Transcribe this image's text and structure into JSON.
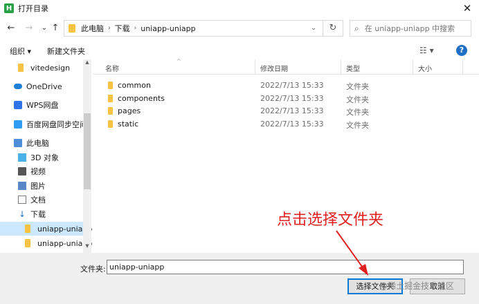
{
  "window": {
    "app_icon_letter": "H",
    "title": "打开目录",
    "close_glyph": "✕"
  },
  "nav": {
    "back_glyph": "←",
    "forward_glyph": "→",
    "history_glyph": "⌄",
    "up_glyph": "↑",
    "breadcrumbs": [
      "此电脑",
      "下载",
      "uniapp-uniapp"
    ],
    "crumb_sep": "›",
    "dropdown_glyph": "⌄",
    "refresh_glyph": "↻",
    "search_placeholder": "在 uniapp-uniapp 中搜索"
  },
  "toolbar": {
    "organize": "组织 ▾",
    "new_folder": "新建文件夹",
    "view_glyph": "☷ ▾",
    "help": "?"
  },
  "tree": [
    {
      "label": "vitedesign",
      "icon": "folder-icon"
    },
    {
      "label": "OneDrive",
      "icon": "cloud-icon"
    },
    {
      "label": "WPS网盘",
      "icon": "wps-icon"
    },
    {
      "label": "百度网盘同步空间",
      "icon": "baidu-icon"
    },
    {
      "label": "此电脑",
      "icon": "computer-icon"
    },
    {
      "label": "3D 对象",
      "icon": "cube-icon"
    },
    {
      "label": "视频",
      "icon": "video-icon"
    },
    {
      "label": "图片",
      "icon": "picture-icon"
    },
    {
      "label": "文档",
      "icon": "document-icon"
    },
    {
      "label": "下载",
      "icon": "download-icon"
    },
    {
      "label": "uniapp-uniapp",
      "icon": "folder-icon",
      "selected": true
    },
    {
      "label": "uniapp-uniapp",
      "icon": "folder-icon"
    }
  ],
  "columns": {
    "name": "名称",
    "modified": "修改日期",
    "type": "类型",
    "size": "大小",
    "sort_caret": "^"
  },
  "files": [
    {
      "name": "common",
      "modified": "2022/7/13 15:33",
      "type": "文件夹"
    },
    {
      "name": "components",
      "modified": "2022/7/13 15:33",
      "type": "文件夹"
    },
    {
      "name": "pages",
      "modified": "2022/7/13 15:33",
      "type": "文件夹"
    },
    {
      "name": "static",
      "modified": "2022/7/13 15:33",
      "type": "文件夹"
    }
  ],
  "footer": {
    "filename_label": "文件夹:",
    "filename_value": "uniapp-uniapp",
    "select_button": "选择文件夹",
    "cancel_button": "取消"
  },
  "annotation": "点击选择文件夹",
  "watermark": "@稀土掘金技术社区",
  "scroll": {
    "up": "▲",
    "down": "▼"
  },
  "colors": {
    "annotation": "#e02020",
    "selection": "#cce8ff",
    "folder": "#f6c344"
  }
}
